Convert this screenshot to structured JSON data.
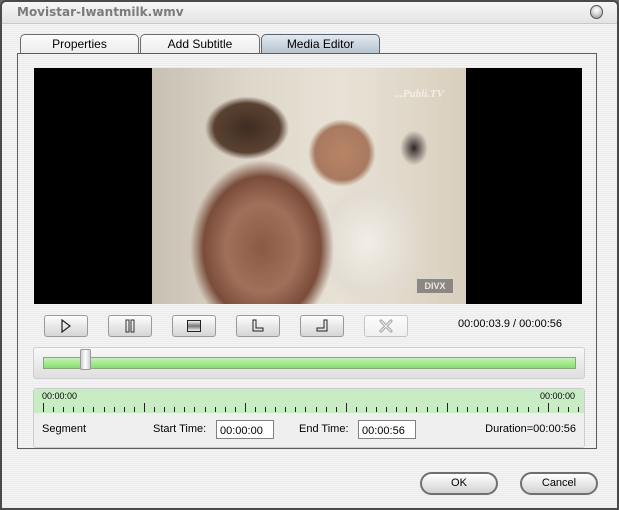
{
  "window": {
    "title": "Movistar-Iwantmilk.wmv",
    "title_button_icon": "orb-close-icon"
  },
  "tabs": [
    {
      "label": "Properties",
      "active": false
    },
    {
      "label": "Add Subtitle",
      "active": false
    },
    {
      "label": "Media Editor",
      "active": true
    }
  ],
  "video": {
    "watermark": "...Publi.TV",
    "badge": "DIVX"
  },
  "controls": {
    "buttons": [
      {
        "name": "play",
        "icon": "play-icon",
        "enabled": true
      },
      {
        "name": "pause",
        "icon": "pause-icon",
        "enabled": true
      },
      {
        "name": "stop",
        "icon": "stop-icon",
        "enabled": true
      },
      {
        "name": "set-start",
        "icon": "mark-in-icon",
        "enabled": true
      },
      {
        "name": "set-end",
        "icon": "mark-out-icon",
        "enabled": true
      },
      {
        "name": "delete",
        "icon": "delete-x-icon",
        "enabled": false
      }
    ],
    "time_readout": "00:00:03.9 / 00:00:56"
  },
  "seek": {
    "position_fraction": 0.07,
    "colors": {
      "track": "#9fe98b"
    }
  },
  "timeline": {
    "start_label": "00:00:00",
    "end_label": "00:00:00",
    "tick_count": 54,
    "major_every": 10,
    "color": "#c8edc4"
  },
  "segment": {
    "label": "Segment",
    "start_time_label": "Start Time:",
    "start_time_value": "00:00:00",
    "end_time_label": "End Time:",
    "end_time_value": "00:00:56",
    "duration_text": "Duration=00:00:56"
  },
  "dialog": {
    "ok_label": "OK",
    "cancel_label": "Cancel"
  }
}
